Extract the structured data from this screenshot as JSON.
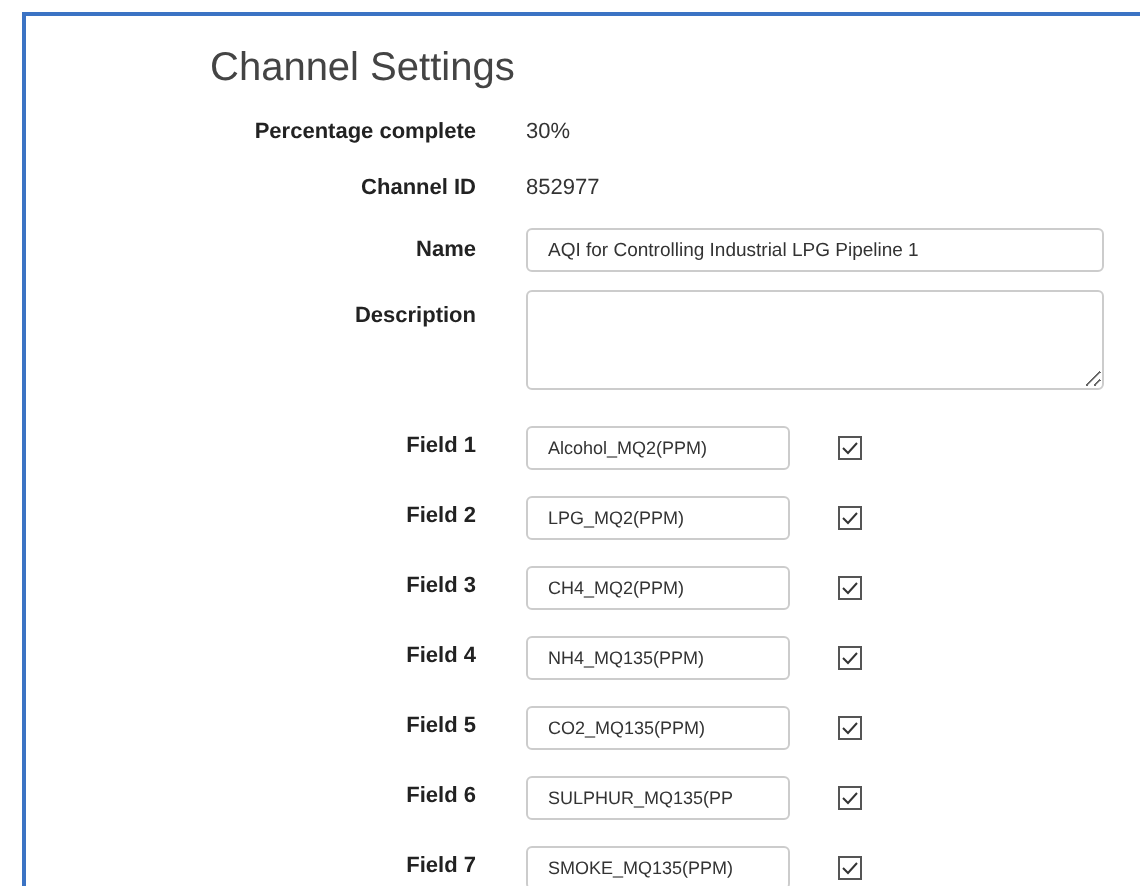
{
  "title": "Channel Settings",
  "info": [
    {
      "label": "Percentage complete",
      "value": "30%"
    },
    {
      "label": "Channel ID",
      "value": "852977"
    }
  ],
  "name": {
    "label": "Name",
    "value": "AQI for Controlling Industrial LPG Pipeline 1"
  },
  "description": {
    "label": "Description"
  },
  "fields": [
    {
      "label": "Field 1",
      "value": "Alcohol_MQ2(PPM)",
      "checked": true
    },
    {
      "label": "Field 2",
      "value": "LPG_MQ2(PPM)",
      "checked": true
    },
    {
      "label": "Field 3",
      "value": "CH4_MQ2(PPM)",
      "checked": true
    },
    {
      "label": "Field 4",
      "value": "NH4_MQ135(PPM)",
      "checked": true
    },
    {
      "label": "Field 5",
      "value": "CO2_MQ135(PPM)",
      "checked": true
    },
    {
      "label": "Field 6",
      "value": "SULPHUR_MQ135(PP",
      "checked": true
    },
    {
      "label": "Field 7",
      "value": "SMOKE_MQ135(PPM)",
      "checked": true
    }
  ]
}
